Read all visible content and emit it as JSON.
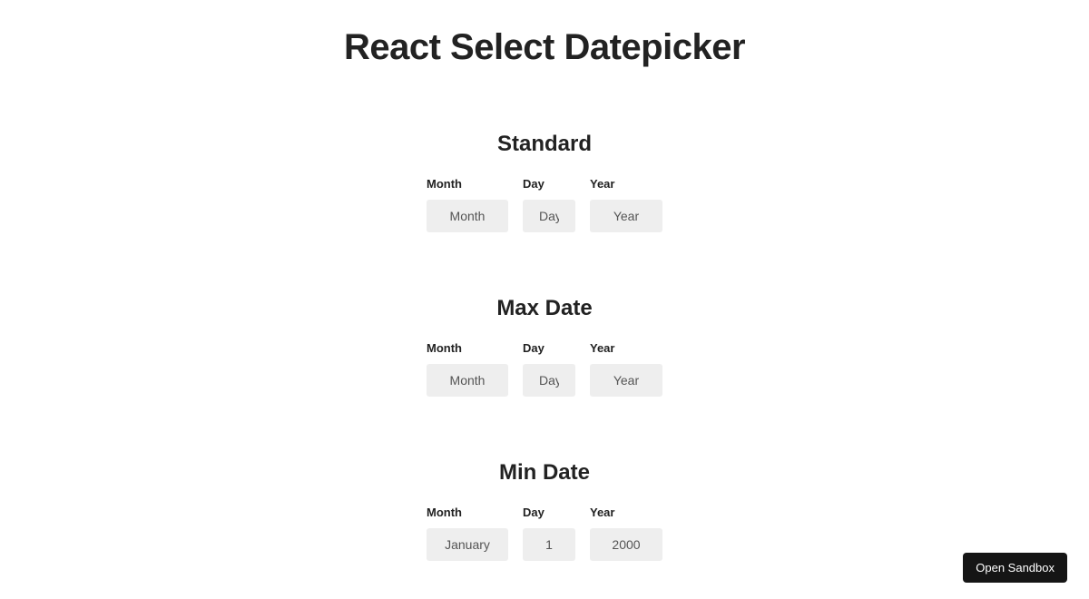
{
  "title": "React Select Datepicker",
  "sections": [
    {
      "heading": "Standard",
      "month_label": "Month",
      "day_label": "Day",
      "year_label": "Year",
      "month_value": "Month",
      "day_value": "Day",
      "year_value": "Year"
    },
    {
      "heading": "Max Date",
      "month_label": "Month",
      "day_label": "Day",
      "year_label": "Year",
      "month_value": "Month",
      "day_value": "Day",
      "year_value": "Year"
    },
    {
      "heading": "Min Date",
      "month_label": "Month",
      "day_label": "Day",
      "year_label": "Year",
      "month_value": "January",
      "day_value": "1",
      "year_value": "2000"
    }
  ],
  "open_sandbox": "Open Sandbox"
}
